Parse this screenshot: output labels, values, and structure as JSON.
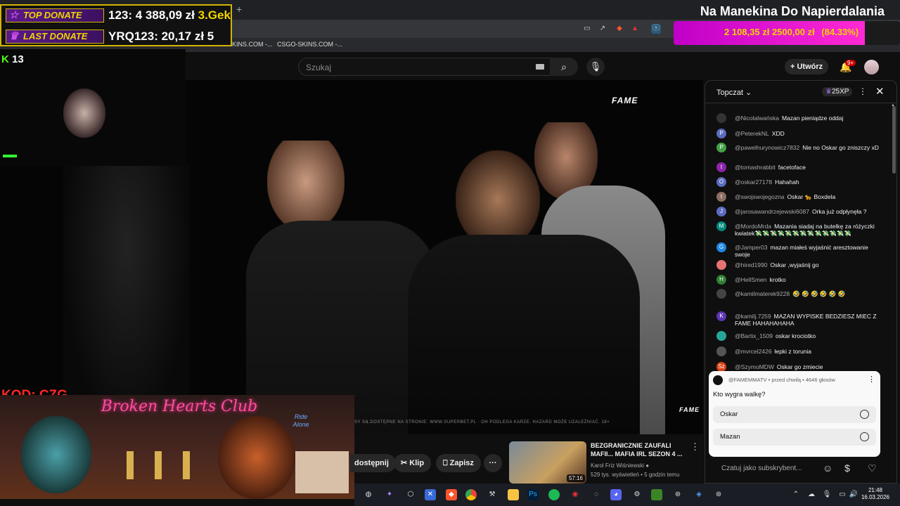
{
  "browser": {
    "new_tab": "+",
    "bookmarks": [
      "KINS.COM -...",
      "CSGO-SKINS.COM -..."
    ]
  },
  "youtube": {
    "search_placeholder": "Szukaj",
    "create_label": "Utwórz",
    "notif_count": "9+"
  },
  "video": {
    "brand": "FAME",
    "disclaimer": "SY SĄ DOSTĘPNE NA STRONIE: WWW.SUPERBET.PL · OH PODLEGA KARZE. HAZARD MOŻE UZALEŻNIAĆ. 18+"
  },
  "overlay": {
    "top_donate_label": "TOP DONATE",
    "top_donate_value": "123: 4 388,09 zł",
    "top_donate_extra": "3.Gek",
    "last_donate_label": "LAST DONATE",
    "last_donate_value": "YRQ123: 20,17 zł 5",
    "kick_viewers": "13",
    "code": "KOD: CZG",
    "bar_title": "Broken Hearts Club",
    "bar_sign": "Ride Alone",
    "goal_title": "Na Manekina Do Napierdalania",
    "goal_current": "2 108,35 zł",
    "goal_target": "2500,00 zł",
    "goal_percent": "(84.33%)",
    "goal_fraction": 0.8433
  },
  "actions": {
    "share_label": "dostępnij",
    "clip_label": "Klip",
    "save_label": "Zapisz",
    "more_label": "···"
  },
  "related": {
    "title": "BEZGRANICZNIE ZAUFALI MAFII... MAFIA IRL SEZON 4 ...",
    "channel": "Karol Friz Wiśniewski",
    "meta": "529 tys. wyświetleń • 5 godzin temu",
    "duration": "57:16"
  },
  "chat": {
    "title": "Topczat",
    "xp": "25XP",
    "messages": [
      {
        "author": "@Nicolalwańska",
        "text": "Mazan pieniądze oddaj",
        "avatar": "",
        "color": "#333"
      },
      {
        "author": "@PeterekNL",
        "text": "XDD",
        "avatar": "P",
        "color": "#5c6bc0"
      },
      {
        "author": "@pawelhurynowicz7832",
        "text": "Nie no Oskar go zniszczy xD",
        "avatar": "P",
        "color": "#43a047"
      },
      {
        "author": "@tomashrabbit",
        "text": "facetoface",
        "avatar": "t",
        "color": "#8e24aa"
      },
      {
        "author": "@oskar27178",
        "text": "Hahahah",
        "avatar": "O",
        "color": "#5c6bc0"
      },
      {
        "author": "@swojswojegozna",
        "text": "Oskar 🐆 Boxdela",
        "avatar": "t",
        "color": "#8d6e63"
      },
      {
        "author": "@jarosawandrzejewski6087",
        "text": "Orka już odpłynęła ?",
        "avatar": "J",
        "color": "#5c6bc0"
      },
      {
        "author": "@MordoMrda",
        "text": "Mazania siadaj na butelkę za różyczki kwiatek💸💸💸💸💸💸💸💸💸💸💸💸💸",
        "avatar": "M",
        "color": "#00897b"
      },
      {
        "author": "@Jamper03",
        "text": "mazan miałeś wyjaśnić aresztowanie swoje",
        "avatar": "G",
        "color": "#1e88e5"
      },
      {
        "author": "@hired1990",
        "text": "Oskar ,wyjaśnij go",
        "avatar": "",
        "color": "#e57373"
      },
      {
        "author": "@HellSmen",
        "text": "krotko",
        "avatar": "H",
        "color": "#2e7d32"
      },
      {
        "author": "@kamilmaterek9228",
        "text": "🤣 🤣 🤣 🤣 🤣 🤣",
        "avatar": "",
        "color": "#444"
      },
      {
        "author": "@kamilj.7259",
        "text": "MAZAN WYPISKE BEDZIESZ MIEC Z FAME HAHAHAHAHA",
        "avatar": "K",
        "color": "#5e35b1"
      },
      {
        "author": "@Bartix_1509",
        "text": "oskar krociotko",
        "avatar": "",
        "color": "#26a69a"
      },
      {
        "author": "@mvrcel2426",
        "text": "łepki z torunia",
        "avatar": "",
        "color": "#555"
      },
      {
        "author": "@SzymoMDW",
        "text": "Oskar go zmiecie",
        "avatar": "Sz",
        "color": "#d84315"
      }
    ],
    "poll": {
      "meta": "@FAMEMMATV • przed chwilą • 4646 głosów",
      "question": "Kto wygra walkę?",
      "options": [
        "Oskar",
        "Mazan"
      ]
    },
    "input_placeholder": "Czatuj jako subskrybent..."
  },
  "taskbar": {
    "time": "21:48",
    "date": "16.03.2026"
  }
}
